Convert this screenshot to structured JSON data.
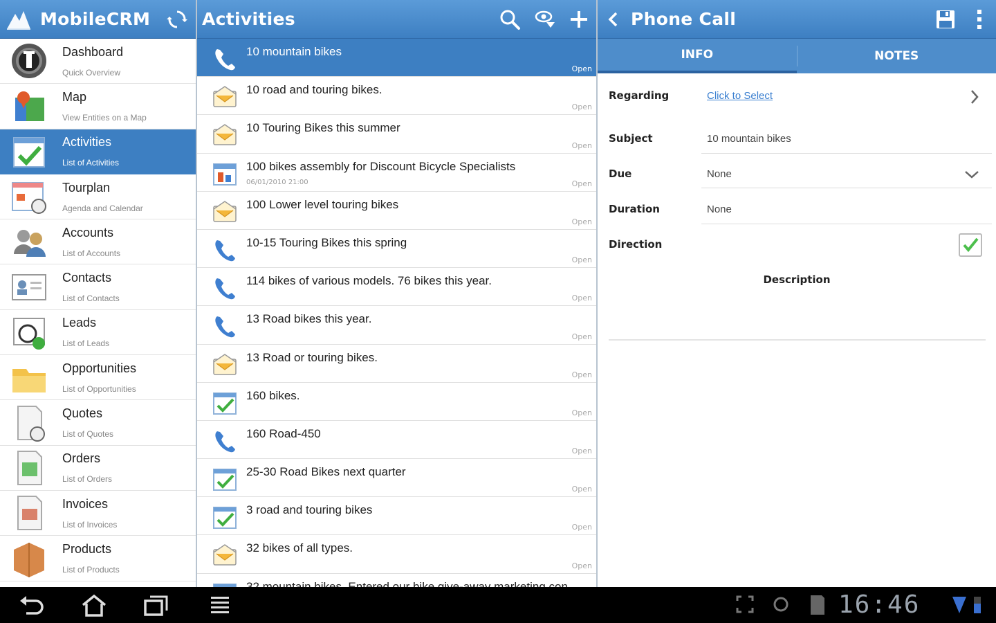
{
  "app": {
    "title": "MobileCRM"
  },
  "list_header": {
    "title": "Activities"
  },
  "detail_header": {
    "title": "Phone Call"
  },
  "sidebar": {
    "items": [
      {
        "label": "Dashboard",
        "sub": "Quick Overview",
        "icon": "dashboard-icon"
      },
      {
        "label": "Map",
        "sub": "View Entities on a Map",
        "icon": "map-icon"
      },
      {
        "label": "Activities",
        "sub": "List of Activities",
        "icon": "activities-icon",
        "selected": true
      },
      {
        "label": "Tourplan",
        "sub": "Agenda and Calendar",
        "icon": "tourplan-icon"
      },
      {
        "label": "Accounts",
        "sub": "List of Accounts",
        "icon": "accounts-icon"
      },
      {
        "label": "Contacts",
        "sub": "List of Contacts",
        "icon": "contacts-icon"
      },
      {
        "label": "Leads",
        "sub": "List of Leads",
        "icon": "leads-icon"
      },
      {
        "label": "Opportunities",
        "sub": "List of Opportunities",
        "icon": "opportunities-icon"
      },
      {
        "label": "Quotes",
        "sub": "List of Quotes",
        "icon": "quotes-icon"
      },
      {
        "label": "Orders",
        "sub": "List of Orders",
        "icon": "orders-icon"
      },
      {
        "label": "Invoices",
        "sub": "List of Invoices",
        "icon": "invoices-icon"
      },
      {
        "label": "Products",
        "sub": "List of Products",
        "icon": "products-icon"
      }
    ]
  },
  "activities": [
    {
      "title": "10 mountain bikes",
      "status": "Open",
      "type": "phone",
      "selected": true
    },
    {
      "title": "10 road and touring bikes.",
      "status": "Open",
      "type": "email"
    },
    {
      "title": "10 Touring Bikes this summer",
      "status": "Open",
      "type": "email"
    },
    {
      "title": "100 bikes assembly for Discount Bicycle Specialists",
      "date": "06/01/2010 21:00",
      "status": "Open",
      "type": "appointment"
    },
    {
      "title": "100 Lower level touring bikes",
      "status": "Open",
      "type": "email"
    },
    {
      "title": "10-15 Touring Bikes this spring",
      "status": "Open",
      "type": "phone"
    },
    {
      "title": "114 bikes of various models. 76 bikes this year.",
      "status": "Open",
      "type": "phone"
    },
    {
      "title": "13 Road bikes this year.",
      "status": "Open",
      "type": "phone"
    },
    {
      "title": "13 Road or touring bikes.",
      "status": "Open",
      "type": "email"
    },
    {
      "title": "160 bikes.",
      "status": "Open",
      "type": "task"
    },
    {
      "title": "160 Road-450",
      "status": "Open",
      "type": "phone"
    },
    {
      "title": "25-30 Road Bikes next quarter",
      "status": "Open",
      "type": "task"
    },
    {
      "title": "3 road and touring bikes",
      "status": "Open",
      "type": "task"
    },
    {
      "title": "32 bikes of all types.",
      "status": "Open",
      "type": "email"
    },
    {
      "title": "32 mountain bikes. Entered our bike give-away marketing con",
      "status": "",
      "type": "task"
    }
  ],
  "detail": {
    "tabs": [
      {
        "label": "INFO",
        "active": true
      },
      {
        "label": "NOTES"
      }
    ],
    "regarding": {
      "label": "Regarding",
      "value": "Click to Select"
    },
    "subject": {
      "label": "Subject",
      "value": "10 mountain bikes"
    },
    "due": {
      "label": "Due",
      "value": "None"
    },
    "duration": {
      "label": "Duration",
      "value": "None"
    },
    "direction": {
      "label": "Direction",
      "checked": true
    },
    "description": {
      "label": "Description"
    }
  },
  "system_bar": {
    "clock": "16:46"
  },
  "colors": {
    "accent": "#3d7fc2",
    "header": "#5b9bd8",
    "link": "#3a7fd0"
  }
}
